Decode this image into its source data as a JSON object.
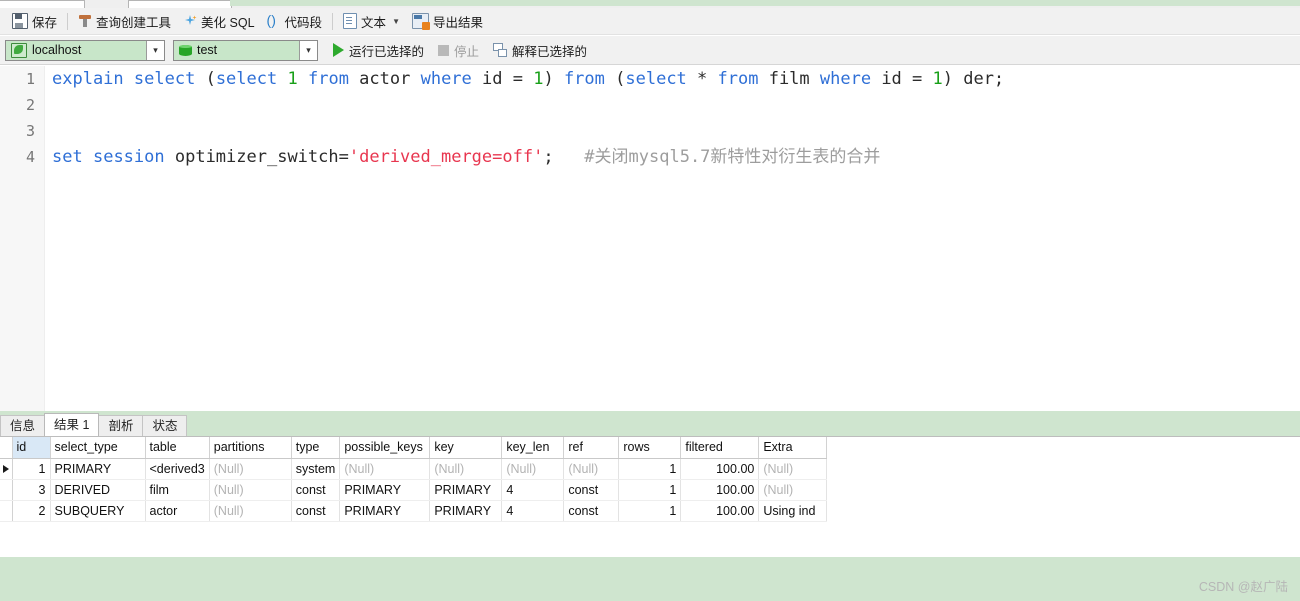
{
  "window": {
    "tab_strip_present": true
  },
  "toolbar": {
    "items": [
      {
        "label": "保存",
        "icon": "save-icon"
      },
      {
        "label": "查询创建工具",
        "icon": "query-builder-icon"
      },
      {
        "label": "美化 SQL",
        "icon": "wand-icon"
      },
      {
        "label": "代码段",
        "icon": "parenthesis-icon"
      },
      {
        "label": "文本",
        "icon": "text-document-icon",
        "has_caret": true
      },
      {
        "label": "导出结果",
        "icon": "export-icon"
      }
    ]
  },
  "connection_bar": {
    "host_combo": {
      "value": "localhost",
      "icon": "host-icon"
    },
    "db_combo": {
      "value": "test",
      "icon": "database-icon"
    },
    "run_selected": {
      "label": "运行已选择的",
      "icon": "run-triangle-icon"
    },
    "stop": {
      "label": "停止",
      "icon": "stop-square-icon",
      "disabled": true
    },
    "explain_selected": {
      "label": "解释已选择的",
      "icon": "explain-icon"
    }
  },
  "editor": {
    "line_numbers": [
      "1",
      "2",
      "3",
      "4"
    ],
    "lines": [
      {
        "number": "1",
        "selected": true,
        "tokens": [
          {
            "t": "explain",
            "c": "kw"
          },
          {
            "t": " ",
            "c": "pln"
          },
          {
            "t": "select",
            "c": "kw"
          },
          {
            "t": " (",
            "c": "pln"
          },
          {
            "t": "select",
            "c": "kw"
          },
          {
            "t": " ",
            "c": "pln"
          },
          {
            "t": "1",
            "c": "num"
          },
          {
            "t": " ",
            "c": "pln"
          },
          {
            "t": "from",
            "c": "kw"
          },
          {
            "t": " actor ",
            "c": "pln"
          },
          {
            "t": "where",
            "c": "kw"
          },
          {
            "t": " id = ",
            "c": "pln"
          },
          {
            "t": "1",
            "c": "num"
          },
          {
            "t": ") ",
            "c": "pln"
          },
          {
            "t": "from",
            "c": "kw"
          },
          {
            "t": " (",
            "c": "pln"
          },
          {
            "t": "select",
            "c": "kw"
          },
          {
            "t": " * ",
            "c": "pln"
          },
          {
            "t": "from",
            "c": "kw"
          },
          {
            "t": " film ",
            "c": "pln"
          },
          {
            "t": "where",
            "c": "kw"
          },
          {
            "t": " id = ",
            "c": "pln"
          },
          {
            "t": "1",
            "c": "num"
          },
          {
            "t": ") der;",
            "c": "pln"
          }
        ],
        "plain": "explain select (select 1 from actor where id = 1) from (select * from film where id = 1) der;"
      },
      {
        "number": "2",
        "selected": false,
        "tokens": [],
        "plain": ""
      },
      {
        "number": "3",
        "selected": false,
        "tokens": [],
        "plain": ""
      },
      {
        "number": "4",
        "selected": false,
        "tokens": [
          {
            "t": "set",
            "c": "kw"
          },
          {
            "t": " ",
            "c": "pln"
          },
          {
            "t": "session",
            "c": "kw"
          },
          {
            "t": " optimizer_switch=",
            "c": "pln"
          },
          {
            "t": "'derived_merge=off'",
            "c": "str"
          },
          {
            "t": ";",
            "c": "pln"
          },
          {
            "t": "   ",
            "c": "pln"
          },
          {
            "t": "#关闭mysql5.7新特性对衍生表的合并",
            "c": "cmt"
          }
        ],
        "plain": "set session optimizer_switch='derived_merge=off';   #关闭mysql5.7新特性对衍生表的合并"
      }
    ]
  },
  "results": {
    "tabs": [
      {
        "label": "信息",
        "active": false
      },
      {
        "label": "结果 1",
        "active": true
      },
      {
        "label": "剖析",
        "active": false
      },
      {
        "label": "状态",
        "active": false
      }
    ],
    "columns": [
      "id",
      "select_type",
      "table",
      "partitions",
      "type",
      "possible_keys",
      "key",
      "key_len",
      "ref",
      "rows",
      "filtered",
      "Extra"
    ],
    "rows": [
      {
        "selected": true,
        "cells": [
          "1",
          "PRIMARY",
          "<derived3",
          "(Null)",
          "system",
          "(Null)",
          "(Null)",
          "(Null)",
          "(Null)",
          "1",
          "100.00",
          "(Null)"
        ]
      },
      {
        "selected": false,
        "cells": [
          "3",
          "DERIVED",
          "film",
          "(Null)",
          "const",
          "PRIMARY",
          "PRIMARY",
          "4",
          "const",
          "1",
          "100.00",
          "(Null)"
        ]
      },
      {
        "selected": false,
        "cells": [
          "2",
          "SUBQUERY",
          "actor",
          "(Null)",
          "const",
          "PRIMARY",
          "PRIMARY",
          "4",
          "const",
          "1",
          "100.00",
          "Using ind"
        ]
      }
    ],
    "null_token": "(Null)"
  },
  "watermark": "CSDN @赵广陆",
  "colors": {
    "pane_green": "#cfe5cf",
    "toolbar_gray": "#f1f1f1",
    "combo_green": "#c8e6c9",
    "selection_blue": "#cfe3fb",
    "keyword_blue": "#2f6fd6",
    "number_green": "#19a019",
    "string_red": "#e8364f",
    "comment_gray": "#9d9d9d",
    "id_header_blue": "#d9e8f6"
  }
}
